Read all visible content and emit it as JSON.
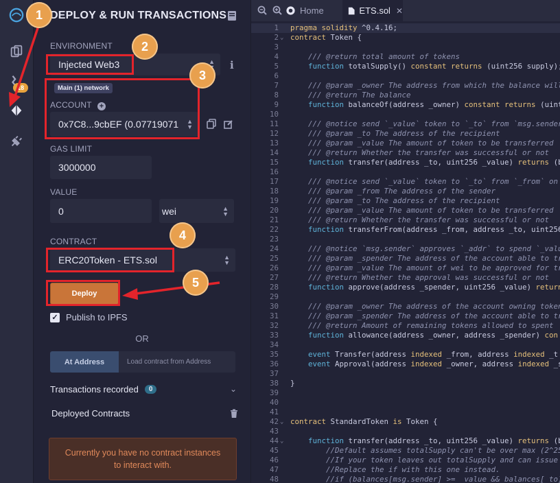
{
  "sidebar": {
    "badge": "18",
    "icons": [
      "remix-logo-icon",
      "file-explorer-icon",
      "compiler-icon",
      "deploy-run-icon",
      "plugin-manager-icon"
    ]
  },
  "panel": {
    "title": "DEPLOY & RUN TRANSACTIONS",
    "environment": {
      "label": "ENVIRONMENT",
      "value": "Injected Web3"
    },
    "network_badge": "Main (1) network",
    "account": {
      "label": "ACCOUNT",
      "value": "0x7C8...9cbEF (0.07719071"
    },
    "gas_limit": {
      "label": "GAS LIMIT",
      "value": "3000000"
    },
    "value": {
      "label": "VALUE",
      "amount": "0",
      "unit": "wei"
    },
    "contract": {
      "label": "CONTRACT",
      "value": "ERC20Token - ETS.sol"
    },
    "deploy_label": "Deploy",
    "publish_label": "Publish to IPFS",
    "or_label": "OR",
    "at_address_label": "At Address",
    "at_address_placeholder": "Load contract from Address",
    "transactions_label": "Transactions recorded",
    "transactions_count": "0",
    "deployed_label": "Deployed Contracts",
    "no_instances_line1": "Currently you have no contract instances",
    "no_instances_line2": "to interact with."
  },
  "annotations": [
    "1",
    "2",
    "3",
    "4",
    "5"
  ],
  "editor": {
    "home_tab": "Home",
    "file_tab": "ETS.sol",
    "lines": [
      [
        [
          "k",
          "pragma solidity "
        ],
        [
          "p",
          "^0.4.16;"
        ]
      ],
      [
        [
          "k",
          "contract "
        ],
        [
          "p",
          "Token {"
        ]
      ],
      [],
      [
        [
          "c",
          "    /// @return total amount of tokens"
        ]
      ],
      [
        [
          "p",
          "    "
        ],
        [
          "f",
          "function "
        ],
        [
          "p",
          "totalSupply() "
        ],
        [
          "k",
          "constant returns "
        ],
        [
          "p",
          "(uint256 supply);"
        ]
      ],
      [],
      [
        [
          "c",
          "    /// @param _owner The address from which the balance will"
        ]
      ],
      [
        [
          "c",
          "    /// @return The balance"
        ]
      ],
      [
        [
          "p",
          "    "
        ],
        [
          "f",
          "function "
        ],
        [
          "p",
          "balanceOf(address _owner) "
        ],
        [
          "k",
          "constant returns "
        ],
        [
          "p",
          "(uint256"
        ]
      ],
      [],
      [
        [
          "c",
          "    /// @notice send `_value` token to `_to` from `msg.sender`"
        ]
      ],
      [
        [
          "c",
          "    /// @param _to The address of the recipient"
        ]
      ],
      [
        [
          "c",
          "    /// @param _value The amount of token to be transferred"
        ]
      ],
      [
        [
          "c",
          "    /// @return Whether the transfer was successful or not"
        ]
      ],
      [
        [
          "p",
          "    "
        ],
        [
          "f",
          "function "
        ],
        [
          "p",
          "transfer(address _to, uint256 _value) "
        ],
        [
          "k",
          "returns "
        ],
        [
          "p",
          "(bool"
        ]
      ],
      [],
      [
        [
          "c",
          "    /// @notice send `_value` token to `_to` from `_from` on"
        ]
      ],
      [
        [
          "c",
          "    /// @param _from The address of the sender"
        ]
      ],
      [
        [
          "c",
          "    /// @param _to The address of the recipient"
        ]
      ],
      [
        [
          "c",
          "    /// @param _value The amount of token to be transferred"
        ]
      ],
      [
        [
          "c",
          "    /// @return Whether the transfer was successful or not"
        ]
      ],
      [
        [
          "p",
          "    "
        ],
        [
          "f",
          "function "
        ],
        [
          "p",
          "transferFrom(address _from, address _to, uint256"
        ]
      ],
      [],
      [
        [
          "c",
          "    /// @notice `msg.sender` approves `_addr` to spend `_value`"
        ]
      ],
      [
        [
          "c",
          "    /// @param _spender The address of the account able to tr"
        ]
      ],
      [
        [
          "c",
          "    /// @param _value The amount of wei to be approved for tr"
        ]
      ],
      [
        [
          "c",
          "    /// @return Whether the approval was successful or not"
        ]
      ],
      [
        [
          "p",
          "    "
        ],
        [
          "f",
          "function "
        ],
        [
          "p",
          "approve(address _spender, uint256 _value) "
        ],
        [
          "k",
          "returns"
        ]
      ],
      [],
      [
        [
          "c",
          "    /// @param _owner The address of the account owning token"
        ]
      ],
      [
        [
          "c",
          "    /// @param _spender The address of the account able to tr"
        ]
      ],
      [
        [
          "c",
          "    /// @return Amount of remaining tokens allowed to spent"
        ]
      ],
      [
        [
          "p",
          "    "
        ],
        [
          "f",
          "function "
        ],
        [
          "p",
          "allowance(address _owner, address _spender) "
        ],
        [
          "k",
          "con"
        ]
      ],
      [],
      [
        [
          "p",
          "    "
        ],
        [
          "f",
          "event "
        ],
        [
          "p",
          "Transfer(address "
        ],
        [
          "k",
          "indexed "
        ],
        [
          "p",
          "_from, address "
        ],
        [
          "k",
          "indexed "
        ],
        [
          "p",
          "_t"
        ]
      ],
      [
        [
          "p",
          "    "
        ],
        [
          "f",
          "event "
        ],
        [
          "p",
          "Approval(address "
        ],
        [
          "k",
          "indexed "
        ],
        [
          "p",
          "_owner, address "
        ],
        [
          "k",
          "indexed "
        ],
        [
          "p",
          "_s"
        ]
      ],
      [],
      [
        [
          "p",
          "}"
        ]
      ],
      [],
      [],
      [],
      [
        [
          "k",
          "contract "
        ],
        [
          "p",
          "StandardToken "
        ],
        [
          "k",
          "is "
        ],
        [
          "p",
          "Token {"
        ]
      ],
      [],
      [
        [
          "p",
          "    "
        ],
        [
          "f",
          "function "
        ],
        [
          "p",
          "transfer(address _to, uint256 _value) "
        ],
        [
          "k",
          "returns "
        ],
        [
          "p",
          "(b"
        ]
      ],
      [
        [
          "c",
          "        //Default assumes totalSupply can't be over max (2^256"
        ]
      ],
      [
        [
          "c",
          "        //If your token leaves out totalSupply and can issue"
        ]
      ],
      [
        [
          "c",
          "        //Replace the if with this one instead."
        ]
      ],
      [
        [
          "c",
          "        //if (balances[msg.sender] >= _value && balances[_to]"
        ]
      ]
    ],
    "fold_lines": [
      2,
      42,
      44
    ]
  }
}
